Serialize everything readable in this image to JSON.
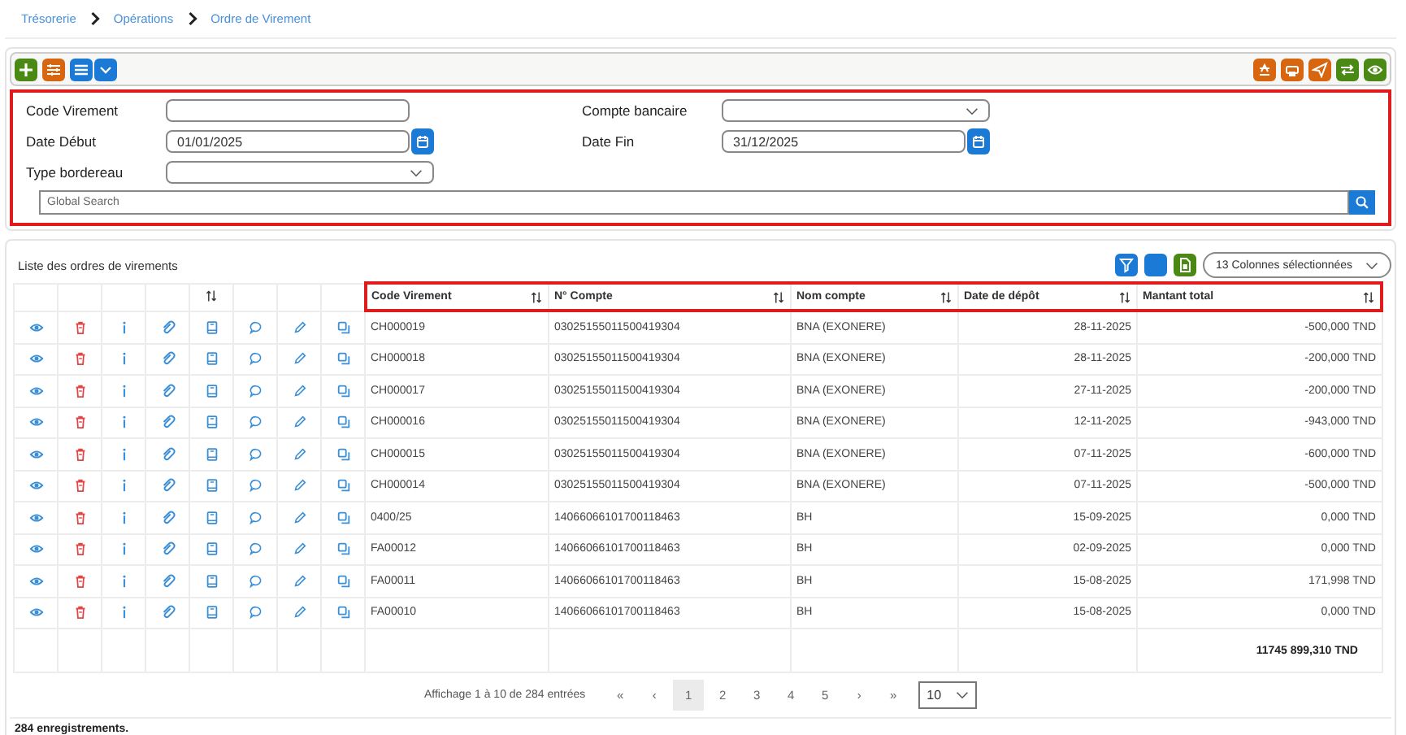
{
  "breadcrumb": [
    {
      "label": "Trésorerie"
    },
    {
      "label": "Opérations"
    },
    {
      "label": "Ordre de Virement"
    }
  ],
  "filters": [
    {
      "label": "Code Virement",
      "kind": "text"
    },
    {
      "label": "Compte bancaire",
      "kind": "select"
    },
    {
      "label": "Date Début",
      "kind": "date",
      "value": "01/01/2025"
    },
    {
      "label": "Date Fin",
      "kind": "date",
      "value": "31/12/2025"
    },
    {
      "label": "Type bordereau",
      "kind": "select"
    }
  ],
  "global_search": {
    "placeholder": "Global Search"
  },
  "list_title": "Liste des ordres de virements",
  "column_selector": "13 Colonnes sélectionnées",
  "table": {
    "columns": [
      "Code Virement",
      "N° Compte",
      "Nom compte",
      "Date de dépôt",
      "Mantant total"
    ],
    "rows": [
      [
        "CH000019",
        "03025155011500419304",
        "BNA (EXONERE)",
        "28-11-2025",
        "-500,000 TND"
      ],
      [
        "CH000018",
        "03025155011500419304",
        "BNA (EXONERE)",
        "28-11-2025",
        "-200,000 TND"
      ],
      [
        "CH000017",
        "03025155011500419304",
        "BNA (EXONERE)",
        "27-11-2025",
        "-200,000 TND"
      ],
      [
        "CH000016",
        "03025155011500419304",
        "BNA (EXONERE)",
        "12-11-2025",
        "-943,000 TND"
      ],
      [
        "CH000015",
        "03025155011500419304",
        "BNA (EXONERE)",
        "07-11-2025",
        "-600,000 TND"
      ],
      [
        "CH000014",
        "03025155011500419304",
        "BNA (EXONERE)",
        "07-11-2025",
        "-500,000 TND"
      ],
      [
        "0400/25",
        "14066066101700118463",
        "BH",
        "15-09-2025",
        "0,000 TND"
      ],
      [
        "FA00012",
        "14066066101700118463",
        "BH",
        "02-09-2025",
        "0,000 TND"
      ],
      [
        "FA00011",
        "14066066101700118463",
        "BH",
        "15-08-2025",
        "171,998 TND"
      ],
      [
        "FA00010",
        "14066066101700118463",
        "BH",
        "15-08-2025",
        "0,000 TND"
      ]
    ],
    "total": "11745 899,310 TND"
  },
  "pagination": {
    "summary": "Affichage 1 à 10 de 284 entrées",
    "first": "«",
    "prev": "‹",
    "pages": [
      {
        "label": "1",
        "selected": true
      },
      {
        "label": "2",
        "selected": false
      },
      {
        "label": "3",
        "selected": false
      },
      {
        "label": "4",
        "selected": false
      },
      {
        "label": "5",
        "selected": false
      }
    ],
    "next": "›",
    "last": "»",
    "page_size": "10"
  },
  "record_count": "284 enregistrements."
}
